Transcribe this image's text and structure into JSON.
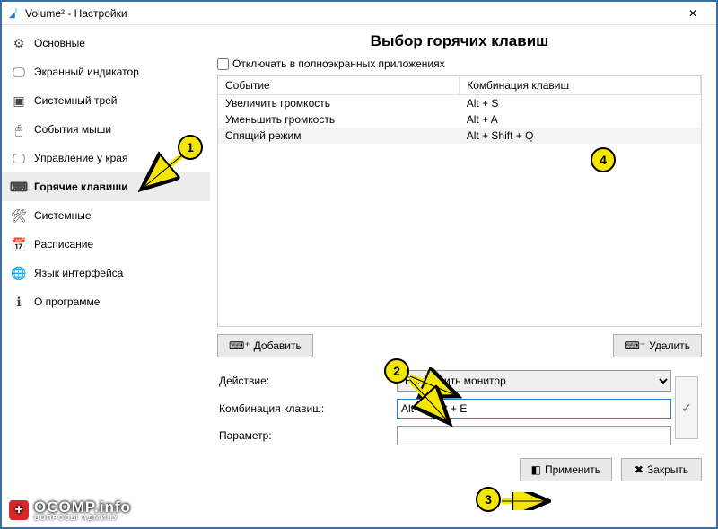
{
  "window": {
    "title": "Volume² - Настройки",
    "close_glyph": "✕"
  },
  "sidebar": {
    "items": [
      {
        "icon": "⚙",
        "label": "Основные"
      },
      {
        "icon": "🖵",
        "label": "Экранный индикатор"
      },
      {
        "icon": "▣",
        "label": "Системный трей"
      },
      {
        "icon": "🖱",
        "label": "События мыши"
      },
      {
        "icon": "🖵",
        "label": "Управление у края"
      },
      {
        "icon": "⌨",
        "label": "Горячие клавиши"
      },
      {
        "icon": "🛠",
        "label": "Системные"
      },
      {
        "icon": "📅",
        "label": "Расписание"
      },
      {
        "icon": "🌐",
        "label": "Язык интерфейса"
      },
      {
        "icon": "ℹ",
        "label": "О программе"
      }
    ],
    "active_index": 5
  },
  "main": {
    "heading": "Выбор горячих клавиш",
    "fullscreen_checkbox": "Отключать в полноэкранных приложениях",
    "table": {
      "headers": [
        "Событие",
        "Комбинация клавиш"
      ],
      "rows": [
        {
          "event": "Увеличить громкость",
          "combo": "Alt + S"
        },
        {
          "event": "Уменьшить громкость",
          "combo": "Alt + A"
        },
        {
          "event": "Спящий режим",
          "combo": "Alt + Shift + Q"
        }
      ],
      "selected_index": 2
    },
    "buttons": {
      "add": "Добавить",
      "delete": "Удалить"
    },
    "form": {
      "action_label": "Действие:",
      "action_value": "Выключить монитор",
      "combo_label": "Комбинация клавиш:",
      "combo_value": "Alt + Shift + E",
      "param_label": "Параметр:",
      "param_value": "",
      "confirm_glyph": "✓"
    },
    "footer": {
      "apply": "Применить",
      "close": "Закрыть"
    }
  },
  "markers": {
    "m1": "1",
    "m2": "2",
    "m3": "3",
    "m4": "4"
  },
  "watermark": {
    "main": "OCOMP.info",
    "sub": "ВОПРОСЫ АДМИНУ"
  }
}
